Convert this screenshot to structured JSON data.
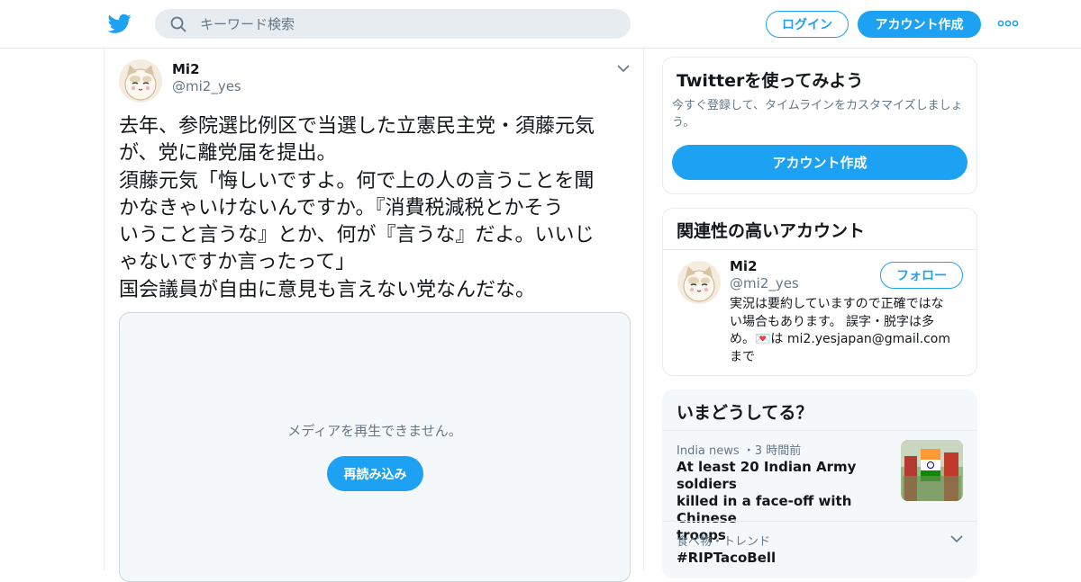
{
  "colors": {
    "accent": "#1da1f2",
    "text": "#14171a",
    "muted": "#657786",
    "border": "#e6ecf0"
  },
  "header": {
    "logo_icon": "twitter-bird-icon",
    "search_placeholder": "キーワード検索",
    "login_label": "ログイン",
    "signup_label": "アカウント作成",
    "more_icon": "more-dots-icon"
  },
  "tweet": {
    "author_name": "Mi2",
    "author_handle": "@mi2_yes",
    "text": "去年、参院選比例区で当選した立憲民主党・須藤元気\nが、党に離党届を提出。\n須藤元気「悔しいですよ。何で上の人の言うことを聞\nかなきゃいけないんですか。『消費税減税とかそう\nいうこと言うな』とか、何が『言うな』だよ。いいじ\nゃないですか言ったって」\n国会議員が自由に意見も言えない党なんだな。",
    "media_error": "メディアを再生できません。",
    "reload_label": "再読み込み"
  },
  "signup_card": {
    "title": "Twitterを使ってみよう",
    "subtitle": "今すぐ登録して、タイムラインをカスタマイズしましょ\nう。",
    "button_label": "アカウント作成"
  },
  "related": {
    "title": "関連性の高いアカウント",
    "name": "Mi2",
    "handle": "@mi2_yes",
    "follow_label": "フォロー",
    "bio": "実況は要約していますので正確ではな\nい場合もあります。 誤字・脱字は多\nめ。💌は mi2.yesjapan@gmail.com\nまで"
  },
  "trends": {
    "title": "いまどうしてる？",
    "items": [
      {
        "meta": "India news ・3 時間前",
        "title": "At least 20 Indian Army soldiers\nkilled in a face-off with Chinese\ntroops"
      },
      {
        "meta": "食べ物・トレンド",
        "title": "#RIPTacoBell"
      }
    ]
  }
}
